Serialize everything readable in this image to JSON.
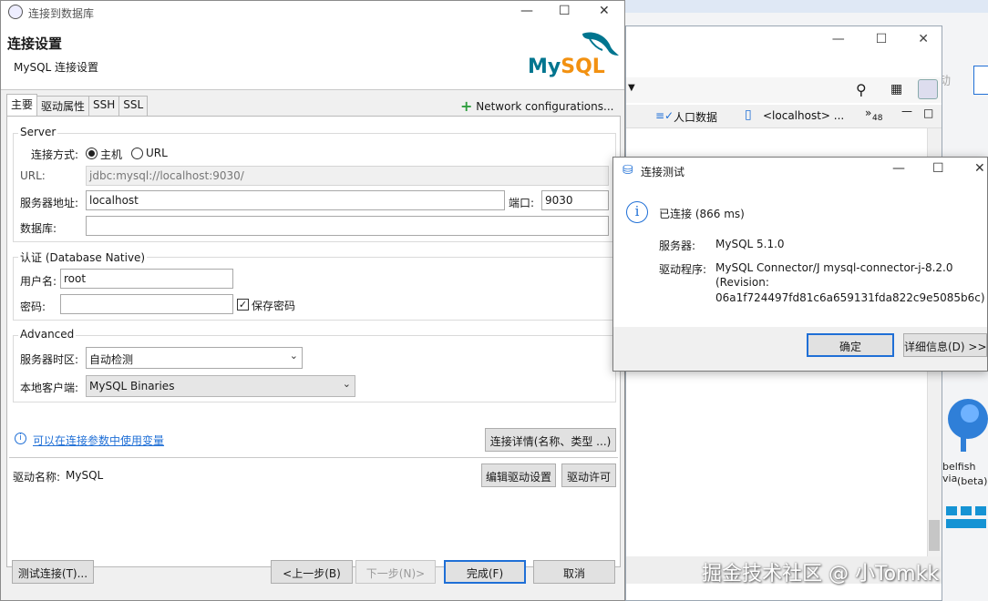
{
  "background_window": {
    "toolbar_items": [
      "人口数据",
      "<localhost> ..."
    ],
    "badge_number": "48",
    "side_texts": [
      "belfish via",
      "(beta)"
    ],
    "partial_text": "动"
  },
  "main_dialog": {
    "window_title": "连接到数据库",
    "header_title": "连接设置",
    "header_subtitle": "MySQL 连接设置",
    "logo_text": "MySQL",
    "tabs": [
      "主要",
      "驱动属性",
      "SSH",
      "SSL"
    ],
    "network_config": "Network configurations...",
    "server": {
      "group_label": "Server",
      "connect_mode_label": "连接方式:",
      "radio_host": "主机",
      "radio_url": "URL",
      "url_label": "URL:",
      "url_value": "jdbc:mysql://localhost:9030/",
      "host_label": "服务器地址:",
      "host_value": "localhost",
      "port_label": "端口:",
      "port_value": "9030",
      "db_label": "数据库:",
      "db_value": ""
    },
    "auth": {
      "group_label": "认证 (Database Native)",
      "user_label": "用户名:",
      "user_value": "root",
      "pass_label": "密码:",
      "pass_value": "",
      "save_password": "保存密码"
    },
    "advanced": {
      "group_label": "Advanced",
      "timezone_label": "服务器时区:",
      "timezone_value": "自动检测",
      "client_label": "本地客户端:",
      "client_value": "MySQL Binaries"
    },
    "variables_link": "可以在连接参数中使用变量",
    "conn_details_button": "连接详情(名称、类型 ...)",
    "driver_label": "驱动名称:",
    "driver_value": "MySQL",
    "edit_driver_button": "编辑驱动设置",
    "driver_license_button": "驱动许可",
    "test_button": "测试连接(T)...",
    "prev_button": "<上一步(B)",
    "next_button": "下一步(N)>",
    "finish_button": "完成(F)",
    "cancel_button": "取消"
  },
  "test_dialog": {
    "title": "连接测试",
    "status": "已连接 (866 ms)",
    "server_label": "服务器:",
    "server_value": "MySQL 5.1.0",
    "driver_label": "驱动程序:",
    "driver_line1": "MySQL Connector/J mysql-connector-j-8.2.0",
    "driver_line2": "(Revision:",
    "driver_line3": "06a1f724497fd81c6a659131fda822c9e5085b6c)",
    "ok_button": "确定",
    "details_button": "详细信息(D) >>"
  },
  "watermark": "掘金技术社区 @ 小Tomkk",
  "colors": {
    "accent": "#1f6fd6",
    "mysql_blue": "#00758f",
    "mysql_orange": "#f29111",
    "plus_green": "#2e9e3e"
  }
}
